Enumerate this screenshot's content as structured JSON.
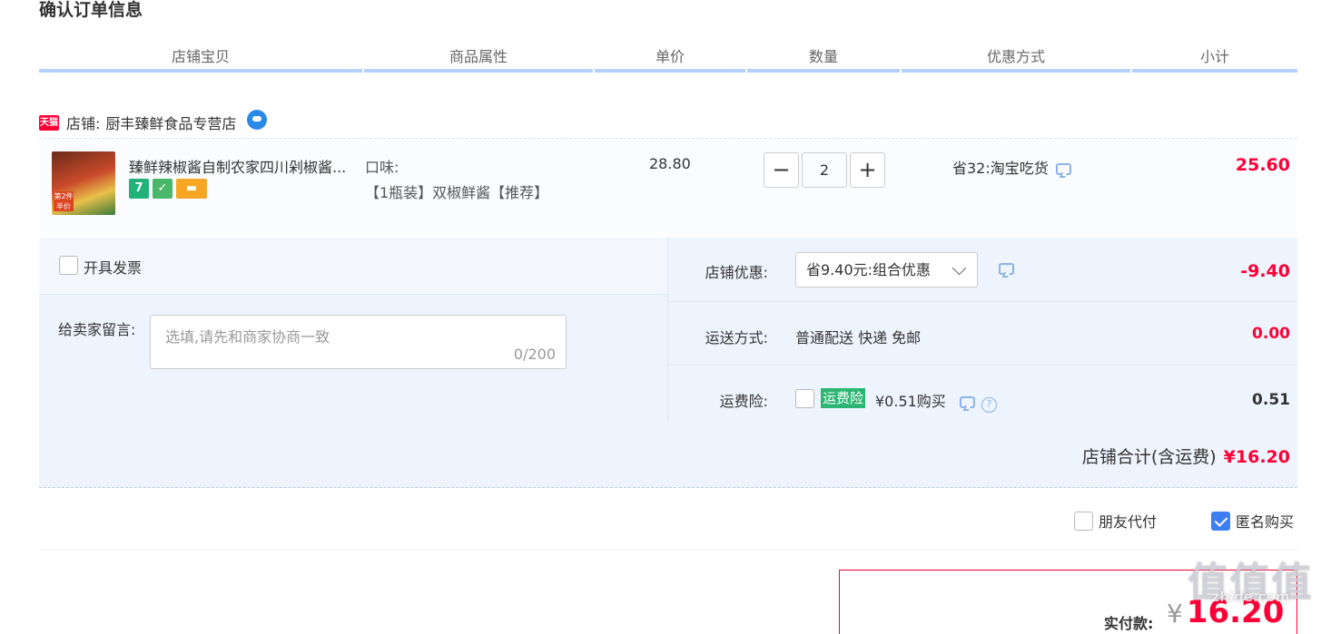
{
  "page_title": "确认订单信息",
  "columns": {
    "item": "店铺宝贝",
    "attr": "商品属性",
    "price": "单价",
    "qty": "数量",
    "promo": "优惠方式",
    "subtotal": "小计"
  },
  "shop": {
    "tmall_badge": "天猫",
    "label": "店铺:",
    "name": "厨丰臻鲜食品专营店"
  },
  "item": {
    "name": "臻鲜辣椒酱自制农家四川剁椒酱...",
    "image_tag": "第2件半价",
    "badge_seven": "7",
    "attr_label": "口味:",
    "attr_value": "【1瓶装】双椒鲜酱【推荐】",
    "unit_price": "28.80",
    "qty_minus": "−",
    "quantity": "2",
    "qty_plus": "+",
    "promo": "省32:淘宝吃货",
    "subtotal": "25.60"
  },
  "invoice": {
    "label": "开具发票"
  },
  "message": {
    "label": "给卖家留言:",
    "placeholder": "选填,请先和商家协商一致",
    "counter": "0/200"
  },
  "shop_discount": {
    "label": "店铺优惠:",
    "selected": "省9.40元:组合优惠",
    "amount": "-9.40"
  },
  "shipping": {
    "label": "运送方式:",
    "method": "普通配送 快递 免邮",
    "amount": "0.00"
  },
  "insurance": {
    "label": "运费险:",
    "tag": "运费险",
    "price": "¥0.51购买",
    "help": "?",
    "amount": "0.51"
  },
  "shop_total": {
    "label": "店铺合计(含运费)",
    "amount": "¥16.20"
  },
  "options": {
    "friend_pay": "朋友代付",
    "anonymous": "匿名购买"
  },
  "payment": {
    "label": "实付款:",
    "currency": "¥",
    "amount": "16.20"
  },
  "watermark": {
    "big": "值值值",
    "small": "zhide.com"
  }
}
